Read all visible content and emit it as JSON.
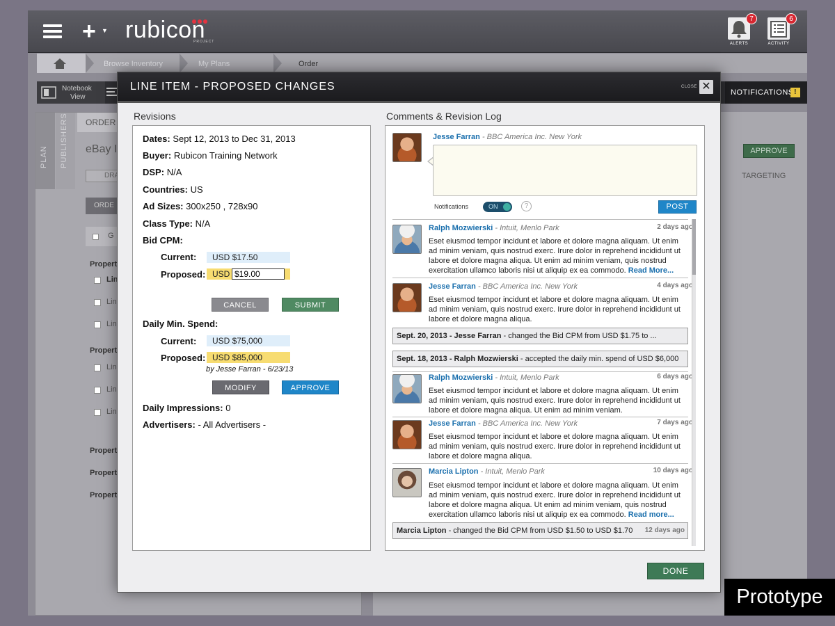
{
  "app": {
    "logo_text": "rubicon",
    "logo_sub": "PROJECT",
    "plus_label": "+",
    "alerts": {
      "label": "ALERTS",
      "count": "7"
    },
    "activity": {
      "label": "ACTIVITY",
      "count": "6"
    }
  },
  "breadcrumb": [
    "Browse Inventory",
    "My Plans",
    "Order"
  ],
  "toolbar": {
    "notebook_line1": "Notebook",
    "notebook_line2": "View",
    "notifications": "NOTIFICATIONS",
    "notif_flag": "!"
  },
  "background": {
    "vtabs": [
      "PLAN",
      "PUBLISHERS"
    ],
    "order_label": "ORDER",
    "page_title": "eBay I",
    "tab_draft": "DRA",
    "tab_order": "ORDE",
    "g_label": "G",
    "property_labels": [
      "Property",
      "Property",
      "Property",
      "Property",
      "Property"
    ],
    "line_labels": [
      "Lin",
      "Line",
      "Line",
      "Line",
      "Line",
      "Line"
    ],
    "approve": "APPROVE",
    "targeting": "TARGETING"
  },
  "modal": {
    "title": "LINE ITEM - PROPOSED CHANGES",
    "close_label": "CLOSE",
    "close_x": "✕",
    "done": "DONE"
  },
  "revisions": {
    "title": "Revisions",
    "dates_label": "Dates:",
    "dates_value": "Sept 12, 2013 to Dec 31, 2013",
    "buyer_label": "Buyer:",
    "buyer_value": "Rubicon Training Network",
    "dsp_label": "DSP:",
    "dsp_value": "N/A",
    "countries_label": "Countries:",
    "countries_value": "US",
    "adsizes_label": "Ad Sizes:",
    "adsizes_value": "300x250 , 728x90",
    "classtype_label": "Class Type:",
    "classtype_value": "N/A",
    "bidcpm_label": "Bid CPM:",
    "current_label": "Current:",
    "proposed_label": "Proposed:",
    "bid_current": "USD $17.50",
    "bid_proposed_currency": "USD",
    "bid_proposed_value": "$19.00",
    "cancel": "CANCEL",
    "submit": "SUBMIT",
    "daily_label": "Daily Min. Spend:",
    "daily_current": "USD $75,000",
    "daily_proposed": "USD $85,000",
    "byline": "by Jesse Farran - 6/23/13",
    "modify": "MODIFY",
    "approve": "APPROVE",
    "impressions_label": "Daily Impressions:",
    "impressions_value": "0",
    "advertisers_label": "Advertisers:",
    "advertisers_value": "- All Advertisers -"
  },
  "comments": {
    "title": "Comments & Revision Log",
    "composer_name": "Jesse Farran",
    "composer_org": "- BBC America Inc. New York",
    "notifications_label": "Notifications",
    "toggle_label": "ON",
    "help_label": "?",
    "post": "POST",
    "entries": [
      {
        "name": "Ralph Mozwierski",
        "org": "- Intuit, Menlo Park",
        "time": "2 days ago",
        "body": "Eset eiusmod tempor incidunt et labore et dolore magna aliquam. Ut enim ad minim veniam, quis nostrud exerc. Irure dolor in reprehend incididunt ut labore et dolore magna aliqua. Ut enim ad minim veniam, quis nostrud exercitation ullamco laboris nisi ut aliquip ex ea commodo.",
        "more": "Read More..."
      },
      {
        "name": "Jesse Farran",
        "org": "- BBC America Inc. New York",
        "time": "4 days ago",
        "body": "Eset eiusmod tempor incidunt et labore et dolore magna aliquam. Ut enim ad minim veniam, quis nostrud exerc. Irure dolor in reprehend incididunt ut labore et dolore magna aliqua.",
        "more": ""
      },
      {
        "name": "Ralph Mozwierski",
        "org": "- Intuit, Menlo Park",
        "time": "6 days ago",
        "body": "Eset eiusmod tempor incidunt et labore et dolore magna aliquam. Ut enim ad minim veniam, quis nostrud exerc. Irure dolor in reprehend incididunt ut labore et dolore magna aliqua. Ut enim ad minim veniam.",
        "more": ""
      },
      {
        "name": "Jesse Farran",
        "org": "- BBC America Inc. New York",
        "time": "7 days ago",
        "body": "Eset eiusmod tempor incidunt et labore et dolore magna aliquam. Ut enim ad minim veniam, quis nostrud exerc. Irure dolor in reprehend incididunt ut labore et dolore magna aliqua.",
        "more": ""
      },
      {
        "name": "Marcia Lipton",
        "org": "- Intuit, Menlo Park",
        "time": "10 days ago",
        "body": "Eset eiusmod tempor incidunt et labore et dolore magna aliquam. Ut enim ad minim veniam, quis nostrud exerc. Irure dolor in reprehend incididunt ut labore et dolore magna aliqua. Ut enim ad minim veniam, quis nostrud exercitation ullamco laboris nisi ut aliquip ex ea commodo.",
        "more": "Read more..."
      }
    ],
    "logs": [
      {
        "who": "Sept. 20, 2013 - Jesse Farran",
        "what": "- changed the Bid CPM from USD $1.75 to ...",
        "time": ""
      },
      {
        "who": "Sept. 18, 2013 - Ralph Mozwierski",
        "what": "- accepted the daily min. spend of USD $6,000",
        "time": ""
      },
      {
        "who": "Marcia Lipton",
        "what": "- changed the Bid CPM from USD $1.50 to USD $1.70",
        "time": "12 days ago"
      }
    ]
  },
  "watermark": "Prototype"
}
